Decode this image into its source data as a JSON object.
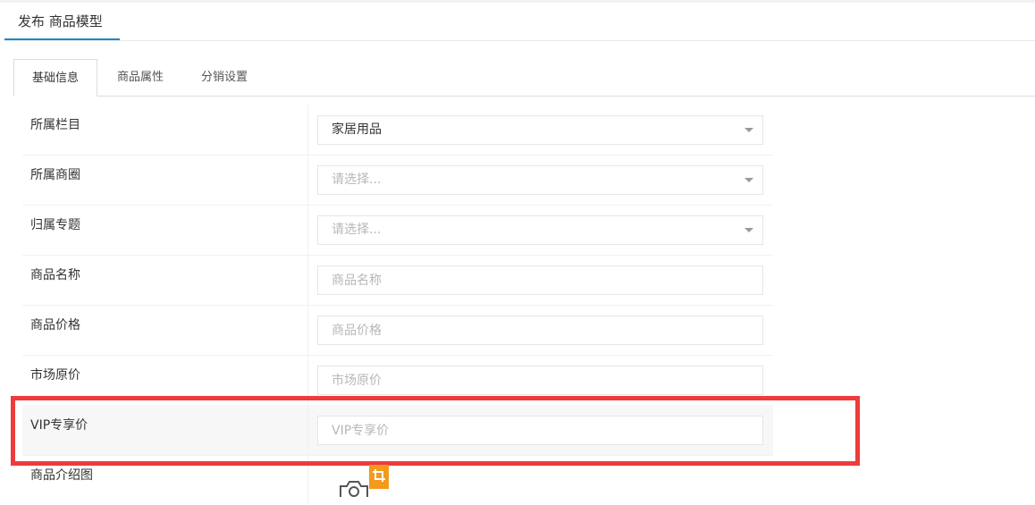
{
  "header": {
    "title": "发布 商品模型"
  },
  "tabs": [
    {
      "label": "基础信息",
      "active": true
    },
    {
      "label": "商品属性",
      "active": false
    },
    {
      "label": "分销设置",
      "active": false
    }
  ],
  "form": {
    "category": {
      "label": "所属栏目",
      "value": "家居用品"
    },
    "circle": {
      "label": "所属商圈",
      "placeholder": "请选择..."
    },
    "topic": {
      "label": "归属专题",
      "placeholder": "请选择..."
    },
    "name": {
      "label": "商品名称",
      "placeholder": "商品名称"
    },
    "price": {
      "label": "商品价格",
      "placeholder": "商品价格"
    },
    "market_price": {
      "label": "市场原价",
      "placeholder": "市场原价"
    },
    "vip_price": {
      "label": "VIP专享价",
      "placeholder": "VIP专享价"
    },
    "image": {
      "label": "商品介绍图"
    }
  },
  "icons": {
    "camera": "camera-icon",
    "crop": "crop-icon"
  },
  "colors": {
    "accent": "#1e88c8",
    "highlight_border": "#ef3b3b",
    "crop_badge": "#f39a1c"
  }
}
